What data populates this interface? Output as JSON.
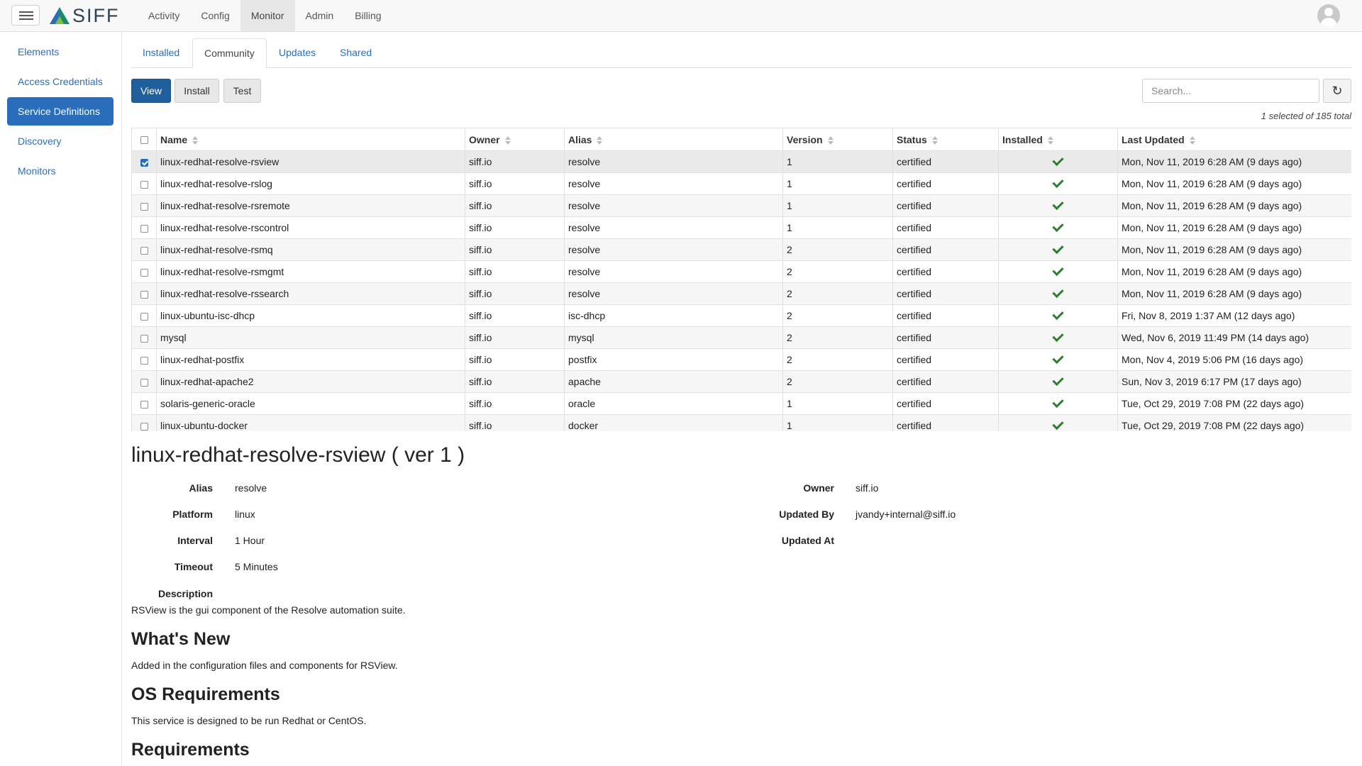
{
  "brand": {
    "name": "SIFF",
    "accent": "#2a6ebb",
    "primary_button": "#1f5f9e",
    "check_color": "#2e7d32"
  },
  "topnav": {
    "links": [
      "Activity",
      "Config",
      "Monitor",
      "Admin",
      "Billing"
    ],
    "active": "Monitor"
  },
  "sidebar": {
    "items": [
      "Elements",
      "Access Credentials",
      "Service Definitions",
      "Discovery",
      "Monitors"
    ],
    "active": "Service Definitions"
  },
  "tabs": {
    "items": [
      "Installed",
      "Community",
      "Updates",
      "Shared"
    ],
    "active": "Community"
  },
  "actions": {
    "view": "View",
    "install": "Install",
    "test": "Test"
  },
  "search": {
    "placeholder": "Search...",
    "value": ""
  },
  "selection_info": "1 selected of 185 total",
  "table": {
    "columns": [
      "Name",
      "Owner",
      "Alias",
      "Version",
      "Status",
      "Installed",
      "Last Updated"
    ],
    "rows": [
      {
        "selected": true,
        "name": "linux-redhat-resolve-rsview",
        "owner": "siff.io",
        "alias": "resolve",
        "version": "1",
        "status": "certified",
        "installed": true,
        "updated": "Mon, Nov 11, 2019 6:28 AM (9 days ago)"
      },
      {
        "selected": false,
        "name": "linux-redhat-resolve-rslog",
        "owner": "siff.io",
        "alias": "resolve",
        "version": "1",
        "status": "certified",
        "installed": true,
        "updated": "Mon, Nov 11, 2019 6:28 AM (9 days ago)"
      },
      {
        "selected": false,
        "name": "linux-redhat-resolve-rsremote",
        "owner": "siff.io",
        "alias": "resolve",
        "version": "1",
        "status": "certified",
        "installed": true,
        "updated": "Mon, Nov 11, 2019 6:28 AM (9 days ago)"
      },
      {
        "selected": false,
        "name": "linux-redhat-resolve-rscontrol",
        "owner": "siff.io",
        "alias": "resolve",
        "version": "1",
        "status": "certified",
        "installed": true,
        "updated": "Mon, Nov 11, 2019 6:28 AM (9 days ago)"
      },
      {
        "selected": false,
        "name": "linux-redhat-resolve-rsmq",
        "owner": "siff.io",
        "alias": "resolve",
        "version": "2",
        "status": "certified",
        "installed": true,
        "updated": "Mon, Nov 11, 2019 6:28 AM (9 days ago)"
      },
      {
        "selected": false,
        "name": "linux-redhat-resolve-rsmgmt",
        "owner": "siff.io",
        "alias": "resolve",
        "version": "2",
        "status": "certified",
        "installed": true,
        "updated": "Mon, Nov 11, 2019 6:28 AM (9 days ago)"
      },
      {
        "selected": false,
        "name": "linux-redhat-resolve-rssearch",
        "owner": "siff.io",
        "alias": "resolve",
        "version": "2",
        "status": "certified",
        "installed": true,
        "updated": "Mon, Nov 11, 2019 6:28 AM (9 days ago)"
      },
      {
        "selected": false,
        "name": "linux-ubuntu-isc-dhcp",
        "owner": "siff.io",
        "alias": "isc-dhcp",
        "version": "2",
        "status": "certified",
        "installed": true,
        "updated": "Fri, Nov 8, 2019 1:37 AM (12 days ago)"
      },
      {
        "selected": false,
        "name": "mysql",
        "owner": "siff.io",
        "alias": "mysql",
        "version": "2",
        "status": "certified",
        "installed": true,
        "updated": "Wed, Nov 6, 2019 11:49 PM (14 days ago)"
      },
      {
        "selected": false,
        "name": "linux-redhat-postfix",
        "owner": "siff.io",
        "alias": "postfix",
        "version": "2",
        "status": "certified",
        "installed": true,
        "updated": "Mon, Nov 4, 2019 5:06 PM (16 days ago)"
      },
      {
        "selected": false,
        "name": "linux-redhat-apache2",
        "owner": "siff.io",
        "alias": "apache",
        "version": "2",
        "status": "certified",
        "installed": true,
        "updated": "Sun, Nov 3, 2019 6:17 PM (17 days ago)"
      },
      {
        "selected": false,
        "name": "solaris-generic-oracle",
        "owner": "siff.io",
        "alias": "oracle",
        "version": "1",
        "status": "certified",
        "installed": true,
        "updated": "Tue, Oct 29, 2019 7:08 PM (22 days ago)"
      },
      {
        "selected": false,
        "name": "linux-ubuntu-docker",
        "owner": "siff.io",
        "alias": "docker",
        "version": "1",
        "status": "certified",
        "installed": true,
        "updated": "Tue, Oct 29, 2019 7:08 PM (22 days ago)"
      }
    ]
  },
  "detail": {
    "title": "linux-redhat-resolve-rsview ( ver 1 )",
    "left": [
      {
        "label": "Alias",
        "value": "resolve"
      },
      {
        "label": "Platform",
        "value": "linux"
      },
      {
        "label": "Interval",
        "value": "1 Hour"
      },
      {
        "label": "Timeout",
        "value": "5 Minutes"
      }
    ],
    "right": [
      {
        "label": "Owner",
        "value": "siff.io"
      },
      {
        "label": "Updated By",
        "value": "jvandy+internal@siff.io"
      },
      {
        "label": "Updated At",
        "value": ""
      }
    ],
    "description_label": "Description",
    "description": "RSView is the gui component of the Resolve automation suite.",
    "whats_new_heading": "What's New",
    "whats_new": "Added in the configuration files and components for RSView.",
    "os_heading": "OS Requirements",
    "os_text": "This service is designed to be run Redhat or CentOS.",
    "requirements_heading": "Requirements"
  }
}
